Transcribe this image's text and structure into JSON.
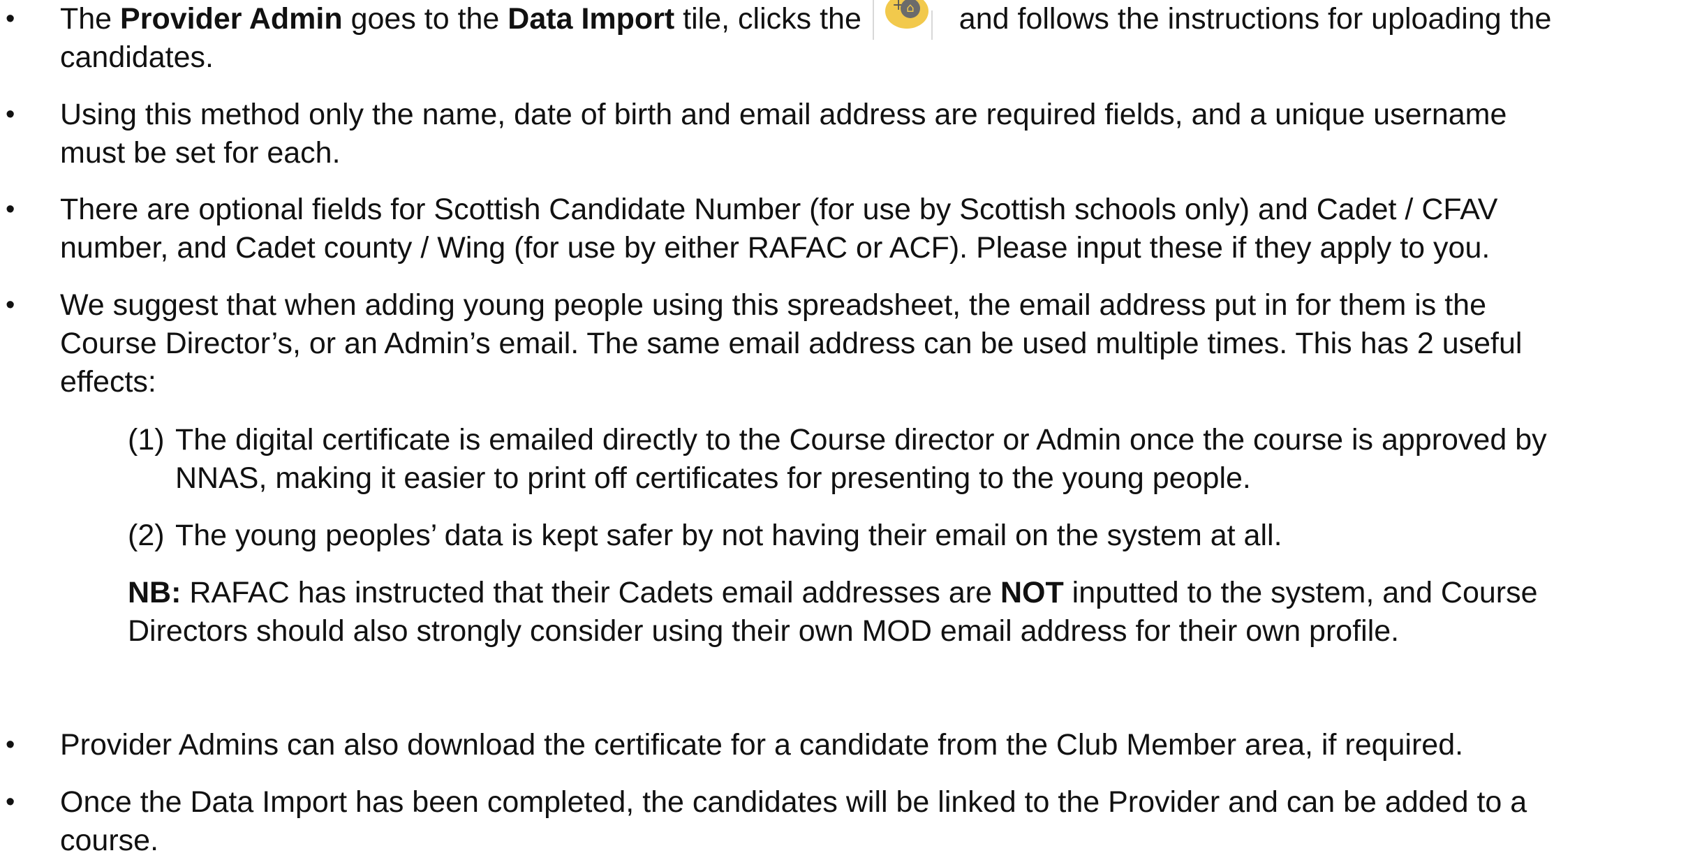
{
  "bullets": {
    "b1": {
      "p1": "The ",
      "b_provider": "Provider Admin",
      "p2": " goes to the ",
      "b_tile": "Data Import",
      "p3": " tile, clicks the",
      "icon": "add-data-import-tile-icon",
      "p4": " and follows the instructions for uploading the",
      "line2": "candidates."
    },
    "b2": {
      "line1": "Using this method only the name, date of birth and email address are required fields, and a unique username",
      "line2": "must be set for each."
    },
    "b3": {
      "line1": "There are optional fields for Scottish Candidate Number (for use by Scottish schools only) and Cadet / CFAV",
      "line2": "number, and Cadet county / Wing (for use by either RAFAC or ACF).  Please input these if they apply to you."
    },
    "b4": {
      "line1": "We suggest that when adding young people using this spreadsheet, the email address put in for them is the",
      "line2": "Course Director’s, or an Admin’s email.  The same email address can be used multiple times.  This has 2 useful",
      "line3": "effects:"
    },
    "b5": {
      "text": "Provider Admins can also download the certificate for a candidate from the Club Member area, if required."
    },
    "b6": {
      "line1": "Once the Data Import has been completed, the candidates will be linked to the Provider and can be added to a",
      "line2": "course."
    }
  },
  "effects": [
    {
      "num": "(1)",
      "line1": "The digital certificate is emailed directly to the Course director or Admin once the course  is approved by",
      "line2": "NNAS, making it easier to print off certificates for presenting to the young people."
    },
    {
      "num": "(2)",
      "line1": "The young peoples’ data is kept safer by not having their email on the system at all."
    }
  ],
  "nb": {
    "label": "NB:",
    "p1": " RAFAC has instructed that their Cadets email addresses are ",
    "b_not": "NOT",
    "p2": " inputted to the system, and Course",
    "line2": "Directors should also strongly consider using their own MOD email address for their own profile."
  },
  "bullet_char": "•"
}
